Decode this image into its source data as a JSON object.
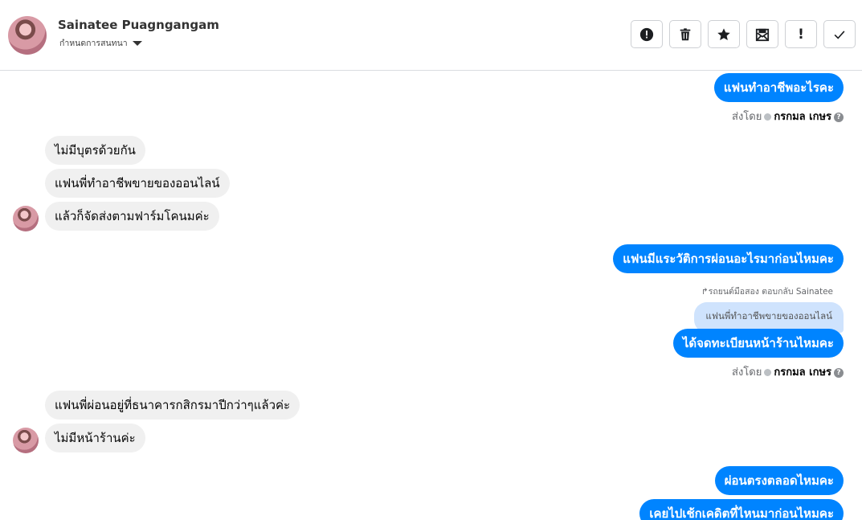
{
  "header": {
    "name": "Sainatee Puagngangam",
    "subtitle": "กำหนดการสนทนา"
  },
  "toolbar": {
    "buttons": [
      {
        "icon": "alert-circle-icon"
      },
      {
        "icon": "trash-icon"
      },
      {
        "icon": "star-icon"
      },
      {
        "icon": "mark-unread-icon"
      },
      {
        "icon": "exclamation-icon",
        "label": "!"
      },
      {
        "icon": "checkmark-icon"
      }
    ]
  },
  "messages": {
    "m1": "แฟนทำอาชีพอะไรคะ",
    "sent1": {
      "prefix": "ส่งโดย",
      "agent": "กรกมล เกษร"
    },
    "m2": "ไม่มีบุตรด้วยกัน",
    "m3": "แฟนพี่ทำอาชีพขายของออนไลน์",
    "m4": "แล้วก็จัดส่งตามฟาร์มโคนมค่ะ",
    "m5": "แฟนมีแระวัติการผ่อนอะไรมาก่อนไหมคะ",
    "reply_meta": "↱รถยนต์มือสอง ตอบกลับ Sainatee",
    "quoted": "แฟนพี่ทำอาชีพขายของออนไลน์",
    "m6": "ได้จดทะเบียนหน้าร้านไหมคะ",
    "sent2": {
      "prefix": "ส่งโดย",
      "agent": "กรกมล เกษร"
    },
    "m7": "แฟนพี่ผ่อนอยู่ที่ธนาคารกสิกรมาปีกว่าๆแล้วค่ะ",
    "m8": "ไม่มีหน้าร้านค่ะ",
    "m9": "ผ่อนตรงตลอดไหมคะ",
    "m10": "เคยไปเช้กเคดิตที่ไหนมาก่อนไหมคะ"
  },
  "colors": {
    "outgoing": "#0084ff",
    "incoming": "#f0f0f0",
    "quoted": "#cfe3fd"
  }
}
